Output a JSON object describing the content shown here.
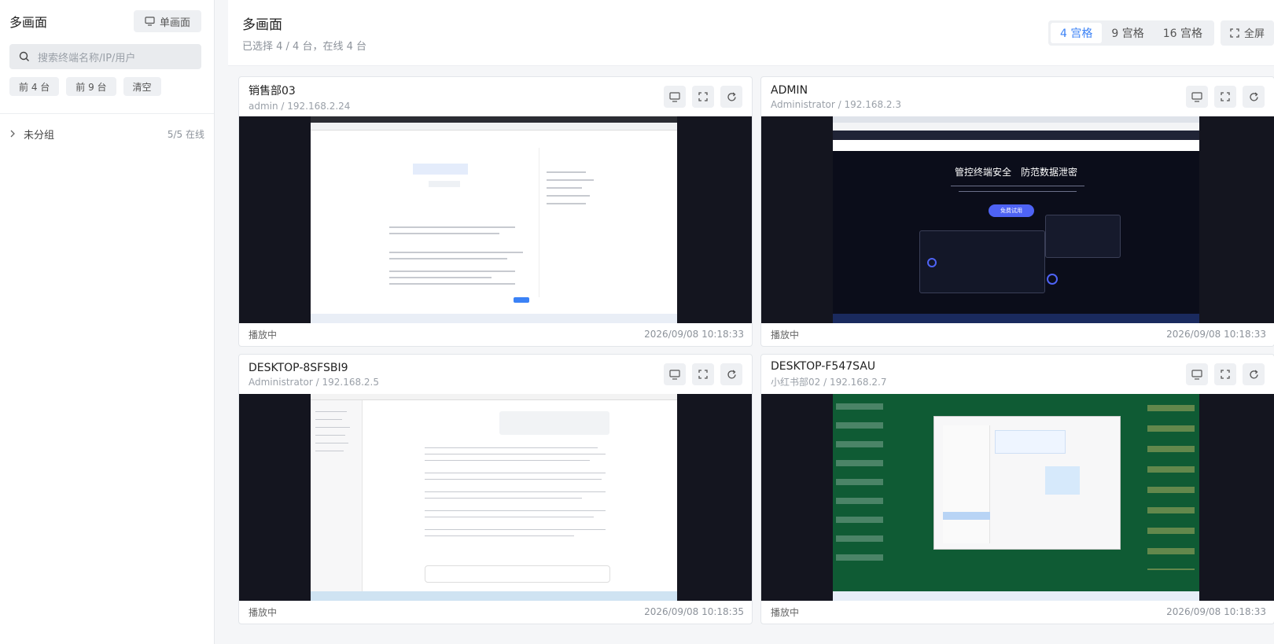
{
  "sidebar": {
    "title": "多画面",
    "single_view_label": "单画面",
    "search_placeholder": "搜索终端名称/IP/用户",
    "quick_filters": [
      "前 4 台",
      "前 9 台",
      "清空"
    ],
    "group": {
      "name": "未分组",
      "count": "5/5 在线"
    }
  },
  "header": {
    "title": "多画面",
    "subtitle": "已选择 4 / 4 台，在线 4 台",
    "layouts": [
      "4 宫格",
      "9 宫格",
      "16 宫格"
    ],
    "active_layout": "4 宫格",
    "fullscreen_label": "全屏"
  },
  "terminals": [
    {
      "name": "销售部03",
      "meta": "admin / 192.168.2.24",
      "status": "播放中",
      "time": "2026/09/08 10:18:33"
    },
    {
      "name": "ADMIN",
      "meta": "Administrator / 192.168.2.3",
      "status": "播放中",
      "time": "2026/09/08 10:18:33"
    },
    {
      "name": "DESKTOP-8SFSBI9",
      "meta": "Administrator / 192.168.2.5",
      "status": "播放中",
      "time": "2026/09/08 10:18:35"
    },
    {
      "name": "DESKTOP-F547SAU",
      "meta": "小红书部02 / 192.168.2.7",
      "status": "播放中",
      "time": "2026/09/08 10:18:33"
    }
  ],
  "screen2": {
    "headline": "管控终端安全　防范数据泄密",
    "cta": "免费试用"
  },
  "colors": {
    "accent": "#3b82f6",
    "dark_screen": "#14151f",
    "desktop_green": "#0f5b34"
  }
}
